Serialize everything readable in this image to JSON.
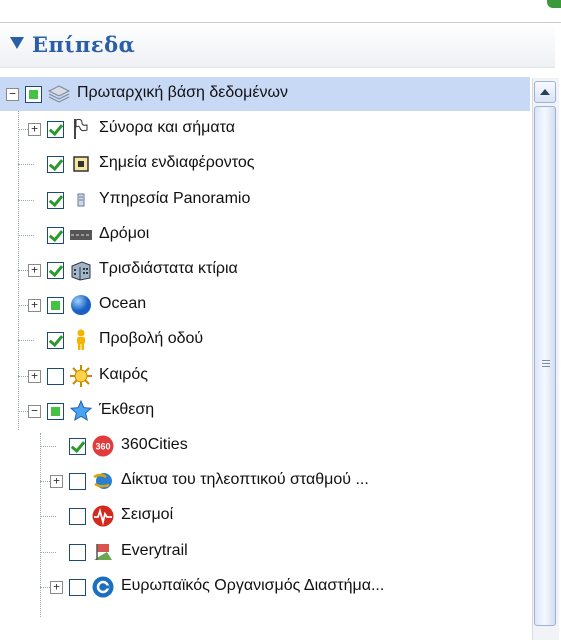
{
  "panel": {
    "title": "Επίπεδα"
  },
  "layers": [
    {
      "label": "Πρωταρχική βάση δεδομένων",
      "level": 0,
      "expander": "minus",
      "check": "partial",
      "icon": "layers-icon",
      "selected": true
    },
    {
      "label": "Σύνορα και σήματα",
      "level": 1,
      "expander": "plus",
      "check": "checked",
      "icon": "flag-icon"
    },
    {
      "label": "Σημεία ενδιαφέροντος",
      "level": 1,
      "expander": "none",
      "check": "checked",
      "icon": "poi-icon"
    },
    {
      "label": "Υπηρεσία Panoramio",
      "level": 1,
      "expander": "none",
      "check": "checked",
      "icon": "panoramio-icon"
    },
    {
      "label": "Δρόμοι",
      "level": 1,
      "expander": "none",
      "check": "checked",
      "icon": "road-icon"
    },
    {
      "label": "Τρισδιάστατα κτίρια",
      "level": 1,
      "expander": "plus",
      "check": "checked",
      "icon": "building-icon"
    },
    {
      "label": "Ocean",
      "level": 1,
      "expander": "plus",
      "check": "partial",
      "icon": "ocean-globe-icon"
    },
    {
      "label": "Προβολή οδού",
      "level": 1,
      "expander": "none",
      "check": "checked",
      "icon": "pegman-icon"
    },
    {
      "label": "Καιρός",
      "level": 1,
      "expander": "plus",
      "check": "unchecked",
      "icon": "weather-sun-icon"
    },
    {
      "label": "Έκθεση",
      "level": 1,
      "expander": "minus",
      "check": "partial",
      "icon": "star-icon"
    },
    {
      "label": "360Cities",
      "level": 2,
      "expander": "none",
      "check": "checked",
      "icon": "360cities-icon"
    },
    {
      "label": "Δίκτυα του τηλεοπτικού σταθμού ...",
      "level": 2,
      "expander": "plus",
      "check": "unchecked",
      "icon": "tv-network-icon"
    },
    {
      "label": "Σεισμοί",
      "level": 2,
      "expander": "none",
      "check": "unchecked",
      "icon": "earthquake-icon"
    },
    {
      "label": "Everytrail",
      "level": 2,
      "expander": "none",
      "check": "unchecked",
      "icon": "everytrail-icon"
    },
    {
      "label": "Ευρωπαϊκός Οργανισμός Διαστήμα...",
      "level": 2,
      "expander": "plus",
      "check": "unchecked",
      "icon": "esa-icon"
    }
  ],
  "colors": {
    "header_text": "#2a5fa8",
    "selection": "#c8d9f6"
  }
}
